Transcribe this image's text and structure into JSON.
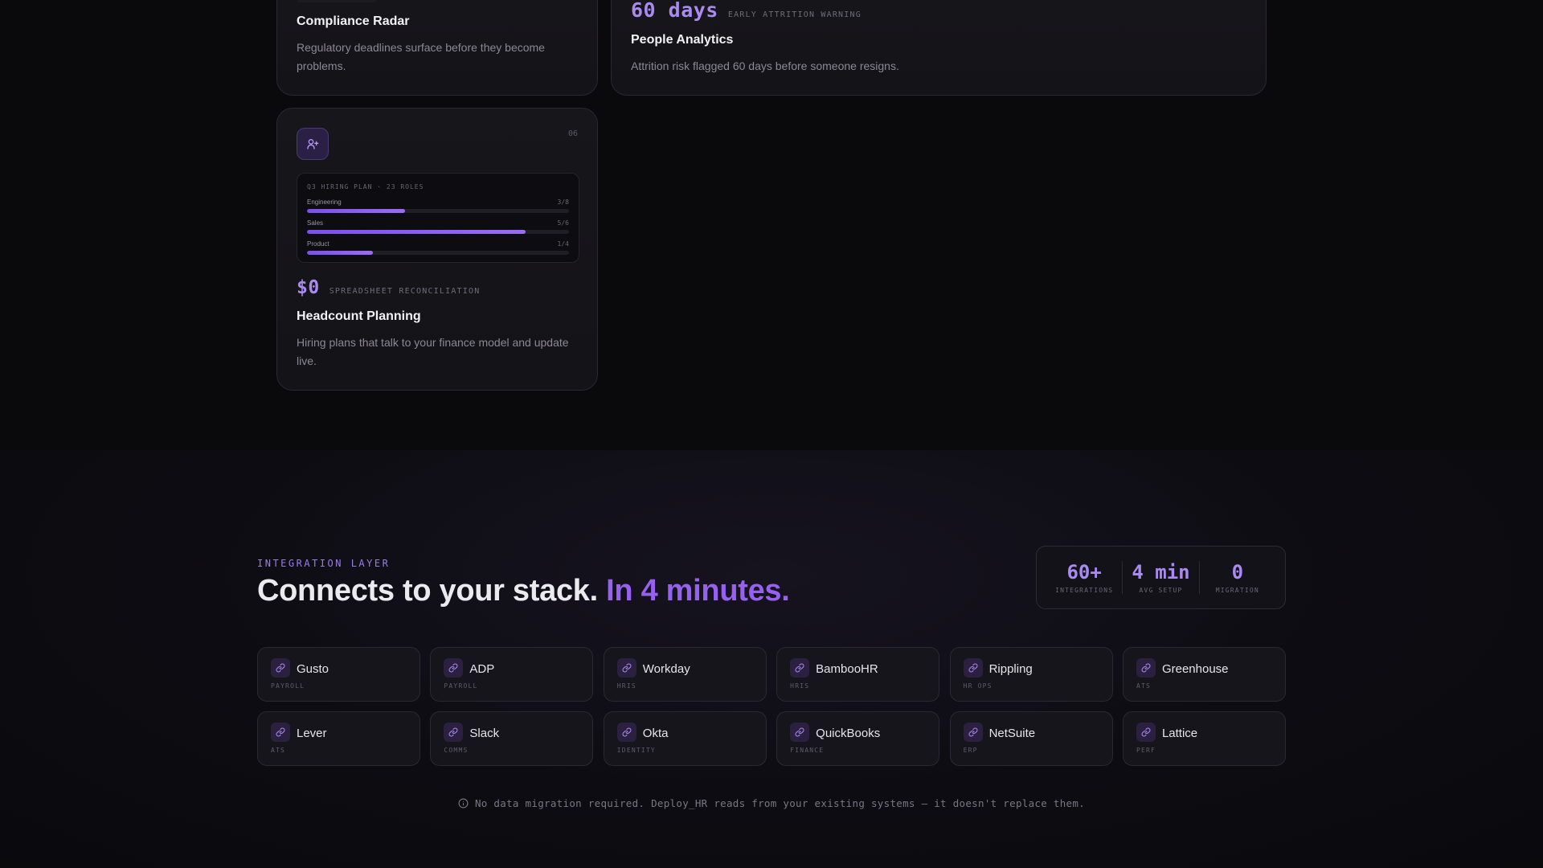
{
  "features": {
    "compliance": {
      "title": "Compliance Radar",
      "description": "Regulatory deadlines surface before they become problems."
    },
    "people": {
      "stat_value": "60 days",
      "stat_label": "EARLY ATTRITION WARNING",
      "title": "People Analytics",
      "description": "Attrition risk flagged 60 days before someone resigns."
    },
    "headcount": {
      "icon": "user-plus-icon",
      "index": "06",
      "panel_title": "Q3 HIRING PLAN · 23 ROLES",
      "rows": [
        {
          "label": "Engineering",
          "count": "3/8",
          "fill": 0.375
        },
        {
          "label": "Sales",
          "count": "5/6",
          "fill": 0.833
        },
        {
          "label": "Product",
          "count": "1/4",
          "fill": 0.25
        }
      ],
      "stat_value": "$0",
      "stat_label": "SPREADSHEET RECONCILIATION",
      "title": "Headcount Planning",
      "description": "Hiring plans that talk to your finance model and update live."
    }
  },
  "integration": {
    "eyebrow": "INTEGRATION LAYER",
    "headline_main": "Connects to your stack.",
    "headline_accent": "In 4 minutes.",
    "stats": [
      {
        "value": "60+",
        "label": "INTEGRATIONS"
      },
      {
        "value": "4 min",
        "label": "AVG SETUP"
      },
      {
        "value": "0",
        "label": "MIGRATION"
      }
    ],
    "tiles": [
      {
        "name": "Gusto",
        "category": "PAYROLL"
      },
      {
        "name": "ADP",
        "category": "PAYROLL"
      },
      {
        "name": "Workday",
        "category": "HRIS"
      },
      {
        "name": "BambooHR",
        "category": "HRIS"
      },
      {
        "name": "Rippling",
        "category": "HR OPS"
      },
      {
        "name": "Greenhouse",
        "category": "ATS"
      },
      {
        "name": "Lever",
        "category": "ATS"
      },
      {
        "name": "Slack",
        "category": "COMMS"
      },
      {
        "name": "Okta",
        "category": "IDENTITY"
      },
      {
        "name": "QuickBooks",
        "category": "FINANCE"
      },
      {
        "name": "NetSuite",
        "category": "ERP"
      },
      {
        "name": "Lattice",
        "category": "PERF"
      }
    ],
    "tile_icon": "link-icon",
    "footnote": "No data migration required. Deploy_HR reads from your existing systems — it doesn't replace them."
  },
  "colors": {
    "accent": "#9561ee",
    "accent_light": "#a98bf0",
    "background": "#0a0a0d"
  }
}
